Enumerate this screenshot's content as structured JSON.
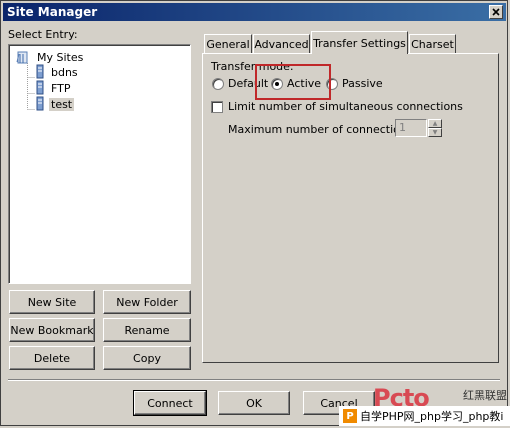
{
  "window": {
    "title": "Site Manager"
  },
  "left": {
    "select_label": "Select Entry:",
    "tree": {
      "root": "My Sites",
      "sites": [
        "bdns",
        "FTP",
        "test"
      ]
    },
    "buttons": {
      "new_site": "New Site",
      "new_folder": "New Folder",
      "new_bookmark": "New Bookmark",
      "rename": "Rename",
      "delete": "Delete",
      "copy": "Copy"
    }
  },
  "tabs": [
    "General",
    "Advanced",
    "Transfer Settings",
    "Charset"
  ],
  "active_tab": "Transfer Settings",
  "transfer": {
    "mode_label": "Transfer mode:",
    "modes": [
      "Default",
      "Active",
      "Passive"
    ],
    "selected_mode": "Active",
    "limit_label": "Limit number of simultaneous connections",
    "limit_checked": false,
    "max_label": "Maximum number of connections:",
    "max_value": "1"
  },
  "footer": {
    "connect": "Connect",
    "ok": "OK",
    "cancel": "Cancel"
  },
  "watermark": {
    "brand": "Pcto",
    "side": "红黑联盟",
    "logo": "P",
    "text": "自学PHP网_php学习_php教i"
  },
  "colors": {
    "title_start": "#0a246a",
    "title_end": "#3a6ea5",
    "highlight": "#c0282a",
    "face": "#d4d0c8"
  }
}
